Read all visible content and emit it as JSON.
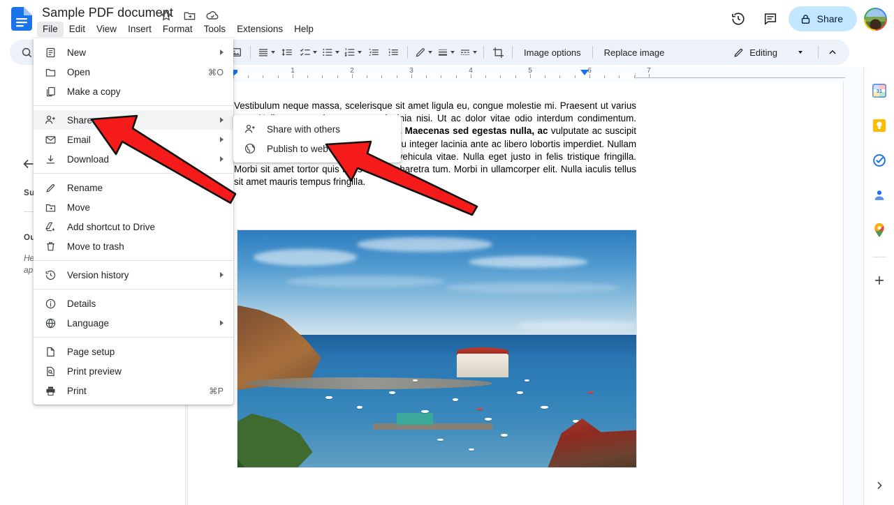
{
  "app": {
    "name": "Google Docs",
    "logo_icon": "docs-logo-icon"
  },
  "header": {
    "doc_title": "Sample PDF document",
    "title_icons": [
      {
        "name": "star-icon",
        "glyph": "☆",
        "label": "Star"
      },
      {
        "name": "move-to-folder-icon",
        "glyph": "▣",
        "label": "Move"
      },
      {
        "name": "cloud-saved-icon",
        "glyph": "☁",
        "label": "Saved to Drive"
      }
    ],
    "menus": [
      {
        "label": "File",
        "active": true
      },
      {
        "label": "Edit",
        "active": false
      },
      {
        "label": "View",
        "active": false
      },
      {
        "label": "Insert",
        "active": false
      },
      {
        "label": "Format",
        "active": false
      },
      {
        "label": "Tools",
        "active": false
      },
      {
        "label": "Extensions",
        "active": false
      },
      {
        "label": "Help",
        "active": false
      }
    ],
    "version_history_icon": "version-history-icon",
    "comments_icon": "comment-icon",
    "share_label": "Share",
    "share_lock_icon": "lock-icon",
    "share_bg": "#c2e7ff",
    "avatar_name": "account-avatar"
  },
  "toolbar": {
    "search_icon": "search-icon",
    "items": [
      {
        "name": "image-button",
        "icon": "image-icon"
      },
      {
        "name": "align-button",
        "icon": "align-left-icon",
        "caret": true
      },
      {
        "name": "line-spacing-button",
        "icon": "line-spacing-icon"
      },
      {
        "name": "checklist-button",
        "icon": "checklist-icon",
        "caret": true
      },
      {
        "name": "bulleted-list-button",
        "icon": "bulleted-list-icon",
        "caret": true
      },
      {
        "name": "numbered-list-button",
        "icon": "numbered-list-icon",
        "caret": true
      },
      {
        "name": "decrease-indent-button",
        "icon": "decrease-indent-icon"
      },
      {
        "name": "increase-indent-button",
        "icon": "increase-indent-icon"
      },
      {
        "name": "pencil-border-button",
        "icon": "pencil-icon",
        "caret": true
      },
      {
        "name": "border-weight-button",
        "icon": "border-weight-icon",
        "caret": true
      },
      {
        "name": "border-dash-button",
        "icon": "border-dash-icon",
        "caret": true
      },
      {
        "name": "crop-button",
        "icon": "crop-icon"
      }
    ],
    "image_options_label": "Image options",
    "replace_image_label": "Replace image",
    "mode_label": "Editing",
    "mode_icon": "pencil-icon",
    "mode_caret": "chevron-down-icon",
    "collapse_icon": "chevron-up-icon"
  },
  "file_menu": {
    "groups": [
      [
        {
          "label": "New",
          "icon": "new-doc-icon",
          "submenu": true,
          "shortcut": "",
          "highlight": false
        },
        {
          "label": "Open",
          "icon": "folder-icon",
          "submenu": false,
          "shortcut": "⌘O",
          "highlight": false
        },
        {
          "label": "Make a copy",
          "icon": "copy-icon",
          "submenu": false,
          "shortcut": "",
          "highlight": false
        }
      ],
      [
        {
          "label": "Share",
          "icon": "share-person-icon",
          "submenu": true,
          "shortcut": "",
          "highlight": true
        },
        {
          "label": "Email",
          "icon": "email-icon",
          "submenu": true,
          "shortcut": "",
          "highlight": false
        },
        {
          "label": "Download",
          "icon": "download-icon",
          "submenu": true,
          "shortcut": "",
          "highlight": false
        }
      ],
      [
        {
          "label": "Rename",
          "icon": "rename-icon",
          "submenu": false,
          "shortcut": "",
          "highlight": false
        },
        {
          "label": "Move",
          "icon": "move-folder-icon",
          "submenu": false,
          "shortcut": "",
          "highlight": false
        },
        {
          "label": "Add shortcut to Drive",
          "icon": "drive-shortcut-icon",
          "submenu": false,
          "shortcut": "",
          "highlight": false
        },
        {
          "label": "Move to trash",
          "icon": "trash-icon",
          "submenu": false,
          "shortcut": "",
          "highlight": false
        }
      ],
      [
        {
          "label": "Version history",
          "icon": "history-icon",
          "submenu": true,
          "shortcut": "",
          "highlight": false
        }
      ],
      [
        {
          "label": "Details",
          "icon": "info-icon",
          "submenu": false,
          "shortcut": "",
          "highlight": false
        },
        {
          "label": "Language",
          "icon": "globe-icon",
          "submenu": true,
          "shortcut": "",
          "highlight": false
        }
      ],
      [
        {
          "label": "Page setup",
          "icon": "page-setup-icon",
          "submenu": false,
          "shortcut": "",
          "highlight": false
        },
        {
          "label": "Print preview",
          "icon": "print-preview-icon",
          "submenu": false,
          "shortcut": "",
          "highlight": false
        },
        {
          "label": "Print",
          "icon": "printer-icon",
          "submenu": false,
          "shortcut": "⌘P",
          "highlight": false
        }
      ]
    ]
  },
  "share_submenu": {
    "items": [
      {
        "label": "Share with others",
        "icon": "share-person-icon"
      },
      {
        "label": "Publish to web",
        "icon": "globe-web-icon"
      }
    ]
  },
  "outline_panel": {
    "back_icon": "arrow-back-icon",
    "summary_heading": "Su",
    "outline_heading": "Ou",
    "hint_line1": "He",
    "hint_line2": "ap"
  },
  "ruler": {
    "numbers": [
      "1",
      "2",
      "3",
      "4",
      "5",
      "6",
      "7"
    ],
    "left_indent_icon": "left-indent-marker",
    "right_indent_icon": "right-indent-marker"
  },
  "document": {
    "paragraph_html": "Vestibulum neque massa, scelerisque sit amet ligula eu, congue molestie mi. Praesent ut varius sem. Nullam at porttitor arcu, nec lacinia nisi. Ut ac dolor vitae odio interdum condimentum. <b>Vivamus sed ipsum cursus convallis. Maecenas sed egestas nulla, ac</b> vulputate ac suscipit et, iaculis non est. Curabitur semper arcu integer lacinia ante ac libero lobortis imperdiet. Nullam mollis convallis ipsum, ac blandit nisl vehicula vitae. Nulla eget justo in felis tristique fringilla. Morbi sit amet tortor quis risus auctor pharetra tum. Morbi in ullamcorper elit. Nulla iaculis tellus sit amet mauris tempus fringilla.",
    "image_name": "harbor-photo",
    "image_alt": "Coastal harbor with boats, hillside and town"
  },
  "right_rail": {
    "items": [
      {
        "name": "google-calendar-icon",
        "label": "Calendar"
      },
      {
        "name": "google-keep-icon",
        "label": "Keep"
      },
      {
        "name": "google-tasks-icon",
        "label": "Tasks"
      },
      {
        "name": "google-contacts-icon",
        "label": "Contacts"
      },
      {
        "name": "google-maps-icon",
        "label": "Maps"
      }
    ],
    "add_label": "+",
    "expand_icon": "chevron-right-icon"
  },
  "annotations": {
    "arrow_color": "#f51b1b",
    "arrows": [
      {
        "name": "arrow-pointing-share",
        "target": "Share"
      },
      {
        "name": "arrow-pointing-publish-to-web",
        "target": "Publish to web"
      }
    ]
  },
  "colors": {
    "toolbar_bg": "#edf2fa",
    "share_bg": "#c2e7ff",
    "menu_highlight": "#f1f3f4",
    "accent_blue": "#1a73e8"
  }
}
